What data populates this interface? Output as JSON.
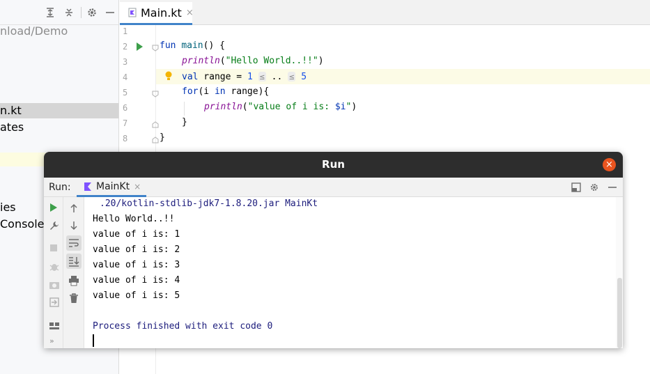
{
  "project": {
    "path_text": "nload/Demo",
    "items": [
      {
        "label": "n.kt"
      },
      {
        "label": "ates"
      },
      {
        "label": "ies"
      },
      {
        "label": " Consoles"
      }
    ]
  },
  "editor": {
    "tab_label": "Main.kt",
    "tab_close": "×",
    "line_numbers": [
      "1",
      "2",
      "3",
      "4",
      "5",
      "6",
      "7",
      "8"
    ],
    "code": {
      "l2_kw": "fun",
      "l2_fn": "main",
      "l2_rest": "() {",
      "l3_fn": "println",
      "l3_str": "\"Hello World..!!\"",
      "l4_kw": "val",
      "l4_mid": " range = ",
      "l4_num1": "1",
      "l4_hint1": "≤",
      "l4_dots": " .. ",
      "l4_hint2": "≤",
      "l4_num2": "5",
      "l5_kw": "for",
      "l5_a": "(i ",
      "l5_in": "in",
      "l5_b": " range){",
      "l6_fn": "println",
      "l6_str_a": "\"value of i is: ",
      "l6_var": "$i",
      "l6_str_b": "\"",
      "l7": "}",
      "l8": "}"
    }
  },
  "run_window": {
    "title": "Run",
    "close_glyph": "×",
    "run_label": "Run:",
    "tab_label": "MainKt",
    "tab_close": "×",
    "console": {
      "command": ".20/kotlin-stdlib-jdk7-1.8.20.jar MainKt",
      "lines": [
        "Hello World..!!",
        "value of i is: 1",
        "value of i is: 2",
        "value of i is: 3",
        "value of i is: 4",
        "value of i is: 5"
      ],
      "exit_message": "Process finished with exit code 0"
    },
    "icons": {
      "rerun": "play-icon",
      "settings": "wrench-icon",
      "stop": "stop-icon",
      "debug": "bug-icon",
      "screenshot": "camera-icon",
      "import": "import-icon",
      "layout": "layout-icon",
      "more": "more-icon"
    }
  },
  "colors": {
    "accent": "#4083c9",
    "run_green": "#3d9f4a",
    "close_orange": "#e9541f",
    "keyword": "#0033b3",
    "string": "#067d17",
    "number": "#1750eb",
    "titlebar": "#2d2d2d"
  }
}
